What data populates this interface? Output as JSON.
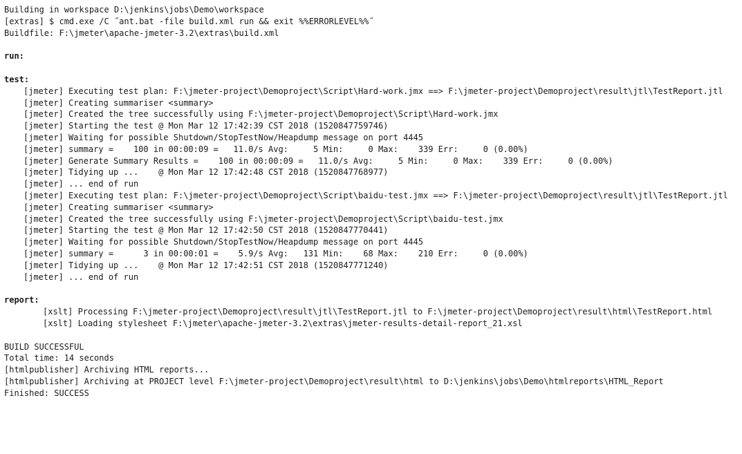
{
  "console": {
    "title": "jenkins-build-console-output",
    "lines": [
      {
        "name": "build-workspace-line",
        "indent": 0,
        "style": "plain",
        "text": "Building in workspace D:\\jenkins\\jobs\\Demo\\workspace"
      },
      {
        "name": "command-line",
        "indent": 0,
        "style": "plain",
        "text": "[extras] $ cmd.exe /C ˝ant.bat -file build.xml run && exit %%ERRORLEVEL%%˝"
      },
      {
        "name": "buildfile-line",
        "indent": 0,
        "style": "plain",
        "text": "Buildfile: F:\\jmeter\\apache-jmeter-3.2\\extras\\build.xml"
      },
      {
        "name": "blank-line",
        "indent": 0,
        "style": "blank",
        "text": ""
      },
      {
        "name": "target-run",
        "indent": 0,
        "style": "target",
        "text": "run:"
      },
      {
        "name": "blank-line",
        "indent": 0,
        "style": "blank",
        "text": ""
      },
      {
        "name": "target-test",
        "indent": 0,
        "style": "target",
        "text": "test:"
      },
      {
        "name": "jmeter-executing-test-plan-1",
        "indent": 1,
        "style": "plain",
        "text": "[jmeter] Executing test plan: F:\\jmeter-project\\Demoproject\\Script\\Hard-work.jmx ==> F:\\jmeter-project\\Demoproject\\result\\jtl\\TestReport.jtl"
      },
      {
        "name": "jmeter-creating-summariser-1",
        "indent": 1,
        "style": "plain",
        "text": "[jmeter] Creating summariser <summary>"
      },
      {
        "name": "jmeter-created-tree-1",
        "indent": 1,
        "style": "plain",
        "text": "[jmeter] Created the tree successfully using F:\\jmeter-project\\Demoproject\\Script\\Hard-work.jmx"
      },
      {
        "name": "jmeter-starting-test-1",
        "indent": 1,
        "style": "plain",
        "text": "[jmeter] Starting the test @ Mon Mar 12 17:42:39 CST 2018 (1520847759746)"
      },
      {
        "name": "jmeter-waiting-shutdown-1",
        "indent": 1,
        "style": "plain",
        "text": "[jmeter] Waiting for possible Shutdown/StopTestNow/Heapdump message on port 4445"
      },
      {
        "name": "jmeter-summary-1",
        "indent": 1,
        "style": "plain",
        "text": "[jmeter] summary =    100 in 00:00:09 =   11.0/s Avg:     5 Min:     0 Max:    339 Err:     0 (0.00%)"
      },
      {
        "name": "jmeter-generate-summary-results-1",
        "indent": 1,
        "style": "plain",
        "text": "[jmeter] Generate Summary Results =    100 in 00:00:09 =   11.0/s Avg:     5 Min:     0 Max:    339 Err:     0 (0.00%)"
      },
      {
        "name": "jmeter-tidying-up-1",
        "indent": 1,
        "style": "plain",
        "text": "[jmeter] Tidying up ...    @ Mon Mar 12 17:42:48 CST 2018 (1520847768977)"
      },
      {
        "name": "jmeter-end-of-run-1",
        "indent": 1,
        "style": "plain",
        "text": "[jmeter] ... end of run"
      },
      {
        "name": "jmeter-executing-test-plan-2",
        "indent": 1,
        "style": "plain",
        "text": "[jmeter] Executing test plan: F:\\jmeter-project\\Demoproject\\Script\\baidu-test.jmx ==> F:\\jmeter-project\\Demoproject\\result\\jtl\\TestReport.jtl"
      },
      {
        "name": "jmeter-creating-summariser-2",
        "indent": 1,
        "style": "plain",
        "text": "[jmeter] Creating summariser <summary>"
      },
      {
        "name": "jmeter-created-tree-2",
        "indent": 1,
        "style": "plain",
        "text": "[jmeter] Created the tree successfully using F:\\jmeter-project\\Demoproject\\Script\\baidu-test.jmx"
      },
      {
        "name": "jmeter-starting-test-2",
        "indent": 1,
        "style": "plain",
        "text": "[jmeter] Starting the test @ Mon Mar 12 17:42:50 CST 2018 (1520847770441)"
      },
      {
        "name": "jmeter-waiting-shutdown-2",
        "indent": 1,
        "style": "plain",
        "text": "[jmeter] Waiting for possible Shutdown/StopTestNow/Heapdump message on port 4445"
      },
      {
        "name": "jmeter-summary-2",
        "indent": 1,
        "style": "plain",
        "text": "[jmeter] summary =      3 in 00:00:01 =    5.9/s Avg:   131 Min:    68 Max:    210 Err:     0 (0.00%)"
      },
      {
        "name": "jmeter-tidying-up-2",
        "indent": 1,
        "style": "plain",
        "text": "[jmeter] Tidying up ...    @ Mon Mar 12 17:42:51 CST 2018 (1520847771240)"
      },
      {
        "name": "jmeter-end-of-run-2",
        "indent": 1,
        "style": "plain",
        "text": "[jmeter] ... end of run"
      },
      {
        "name": "blank-line",
        "indent": 0,
        "style": "blank",
        "text": ""
      },
      {
        "name": "target-report",
        "indent": 0,
        "style": "target",
        "text": "report:"
      },
      {
        "name": "xslt-processing-line",
        "indent": 2,
        "style": "plain",
        "text": "[xslt] Processing F:\\jmeter-project\\Demoproject\\result\\jtl\\TestReport.jtl to F:\\jmeter-project\\Demoproject\\result\\html\\TestReport.html"
      },
      {
        "name": "xslt-loading-stylesheet-line",
        "indent": 2,
        "style": "plain",
        "text": "[xslt] Loading stylesheet F:\\jmeter\\apache-jmeter-3.2\\extras\\jmeter-results-detail-report_21.xsl"
      },
      {
        "name": "blank-line",
        "indent": 0,
        "style": "blank",
        "text": ""
      },
      {
        "name": "build-successful-line",
        "indent": 0,
        "style": "result",
        "text": "BUILD SUCCESSFUL"
      },
      {
        "name": "total-time-line",
        "indent": 0,
        "style": "plain",
        "text": "Total time: 14 seconds"
      },
      {
        "name": "htmlpublisher-archiving-line",
        "indent": 0,
        "style": "plain",
        "text": "[htmlpublisher] Archiving HTML reports..."
      },
      {
        "name": "htmlpublisher-archiving-project-line",
        "indent": 0,
        "style": "plain",
        "text": "[htmlpublisher] Archiving at PROJECT level F:\\jmeter-project\\Demoproject\\result\\html to D:\\jenkins\\jobs\\Demo\\htmlreports\\HTML_Report"
      },
      {
        "name": "finished-status-line",
        "indent": 0,
        "style": "plain",
        "text": "Finished: SUCCESS"
      }
    ]
  }
}
